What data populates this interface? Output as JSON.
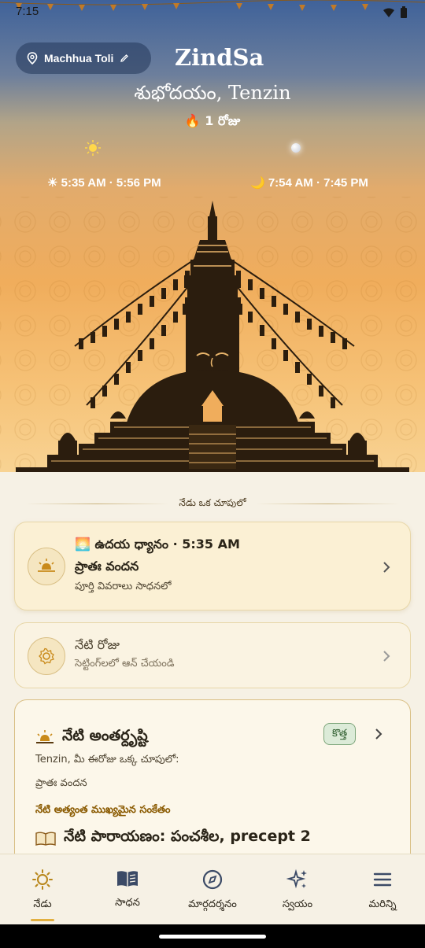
{
  "status_bar": {
    "time": "7:15"
  },
  "header": {
    "location": "Machhua Toli",
    "app_title": "ZindSa",
    "greeting": "శుభోదయం, Tenzin",
    "streak": "🔥 1 రోజు",
    "sun_times": "☀ 5:35 AM · 5:56 PM",
    "moon_times": "🌙 7:54 AM · 7:45 PM"
  },
  "section": {
    "title": "నేడు ఒక చూపులో"
  },
  "cards": {
    "meditation": {
      "title": "🌅 ఉదయ ధ్యానం · 5:35 AM",
      "subtitle": "ప్రాతః వందన",
      "description": "పూర్తి వివరాలు సాధనలో"
    },
    "today_day": {
      "title": "నేటి రోజు",
      "description": "సెట్టింగ్‌లలో ఆన్ చేయండి"
    },
    "insight": {
      "title": "నేటి అంతర్దృష్టి",
      "badge": "కొత్త",
      "line1": "Tenzin, మీ ఈరోజు ఒక్క చూపులో:",
      "line2": "ప్రాతః వందన",
      "signal_label": "నేటి అత్యంత ముఖ్యమైన సంకేతం",
      "reading": "నేటి పారాయణం: పంచశీల, precept 2"
    }
  },
  "nav": {
    "items": [
      {
        "label": "నేడు",
        "icon": "sun-icon"
      },
      {
        "label": "సాధన",
        "icon": "book-icon"
      },
      {
        "label": "మార్గదర్శనం",
        "icon": "compass-icon"
      },
      {
        "label": "స్వయం",
        "icon": "sparkles-icon"
      },
      {
        "label": "మరిన్ని",
        "icon": "menu-icon"
      }
    ]
  },
  "colors": {
    "accent": "#e2b040",
    "card_border": "#d9bf85",
    "badge_bg": "#dcebd8"
  }
}
